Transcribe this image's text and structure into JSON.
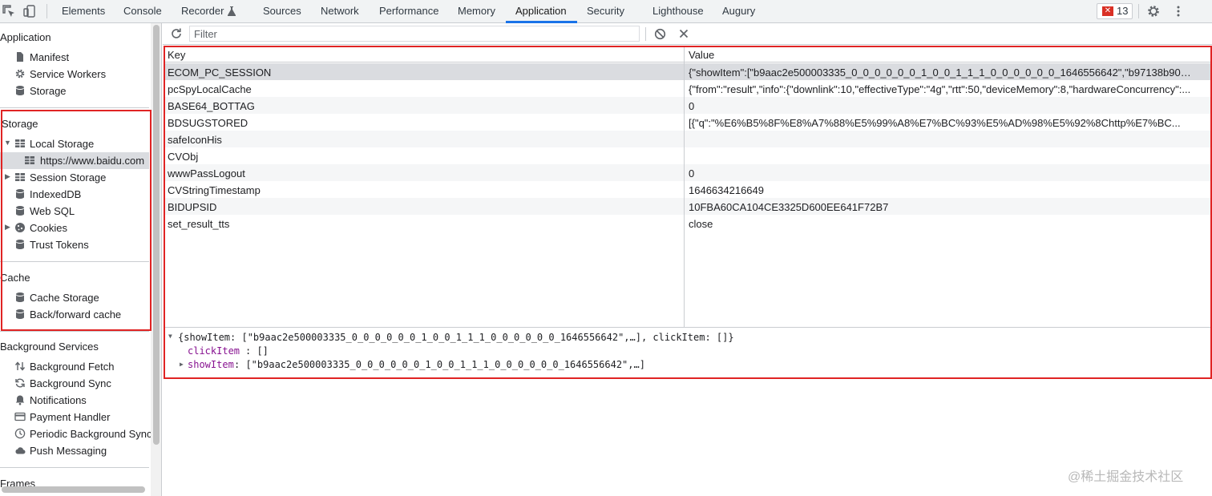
{
  "toolbar": {
    "tabs": [
      "Elements",
      "Console",
      "Recorder",
      "Sources",
      "Network",
      "Performance",
      "Memory",
      "Application",
      "Security",
      "Lighthouse",
      "Augury"
    ],
    "active_tab": "Application",
    "error_count": "13",
    "accent": "#1a73e8",
    "error_color": "#d93025"
  },
  "sidebar": {
    "application": {
      "title": "Application",
      "items": [
        "Manifest",
        "Service Workers",
        "Storage"
      ]
    },
    "storage": {
      "title": "Storage",
      "items": [
        "Local Storage",
        "https://www.baidu.com",
        "Session Storage",
        "IndexedDB",
        "Web SQL",
        "Cookies",
        "Trust Tokens"
      ]
    },
    "cache": {
      "title": "Cache",
      "items": [
        "Cache Storage",
        "Back/forward cache"
      ]
    },
    "background": {
      "title": "Background Services",
      "items": [
        "Background Fetch",
        "Background Sync",
        "Notifications",
        "Payment Handler",
        "Periodic Background Sync",
        "Push Messaging"
      ]
    },
    "frames_title": "Frames"
  },
  "filter": {
    "placeholder": "Filter"
  },
  "table": {
    "headers": [
      "Key",
      "Value"
    ],
    "rows": [
      {
        "key": "ECOM_PC_SESSION",
        "value": "{\"showItem\":[\"b9aac2e500003335_0_0_0_0_0_0_1_0_0_1_1_1_0_0_0_0_0_0_1646556642\",\"b97138b9000e4..."
      },
      {
        "key": "pcSpyLocalCache",
        "value": "{\"from\":\"result\",\"info\":{\"downlink\":10,\"effectiveType\":\"4g\",\"rtt\":50,\"deviceMemory\":8,\"hardwareConcurrency\":..."
      },
      {
        "key": "BASE64_BOTTAG",
        "value": "0"
      },
      {
        "key": "BDSUGSTORED",
        "value": "[{\"q\":\"%E6%B5%8F%E8%A7%88%E5%99%A8%E7%BC%93%E5%AD%98%E5%92%8Chttp%E7%BC..."
      },
      {
        "key": "safeIconHis",
        "value": ""
      },
      {
        "key": "CVObj",
        "value": ""
      },
      {
        "key": "wwwPassLogout",
        "value": "0"
      },
      {
        "key": "CVStringTimestamp",
        "value": "1646634216649"
      },
      {
        "key": "BIDUPSID",
        "value": "10FBA60CA104CE3325D600EE641F72B7"
      },
      {
        "key": "set_result_tts",
        "value": "close"
      }
    ]
  },
  "preview": {
    "line1": "{showItem: [\"b9aac2e500003335_0_0_0_0_0_0_1_0_0_1_1_1_0_0_0_0_0_0_1646556642\",…], clickItem: []}",
    "clickItem_key": "clickItem",
    "clickItem_val": ": []",
    "showItem_key": "showItem",
    "showItem_val": ": [\"b9aac2e500003335_0_0_0_0_0_0_1_0_0_1_1_1_0_0_0_0_0_0_1646556642\",…]"
  },
  "watermark": "@稀土掘金技术社区",
  "highlight_color": "#e02424"
}
